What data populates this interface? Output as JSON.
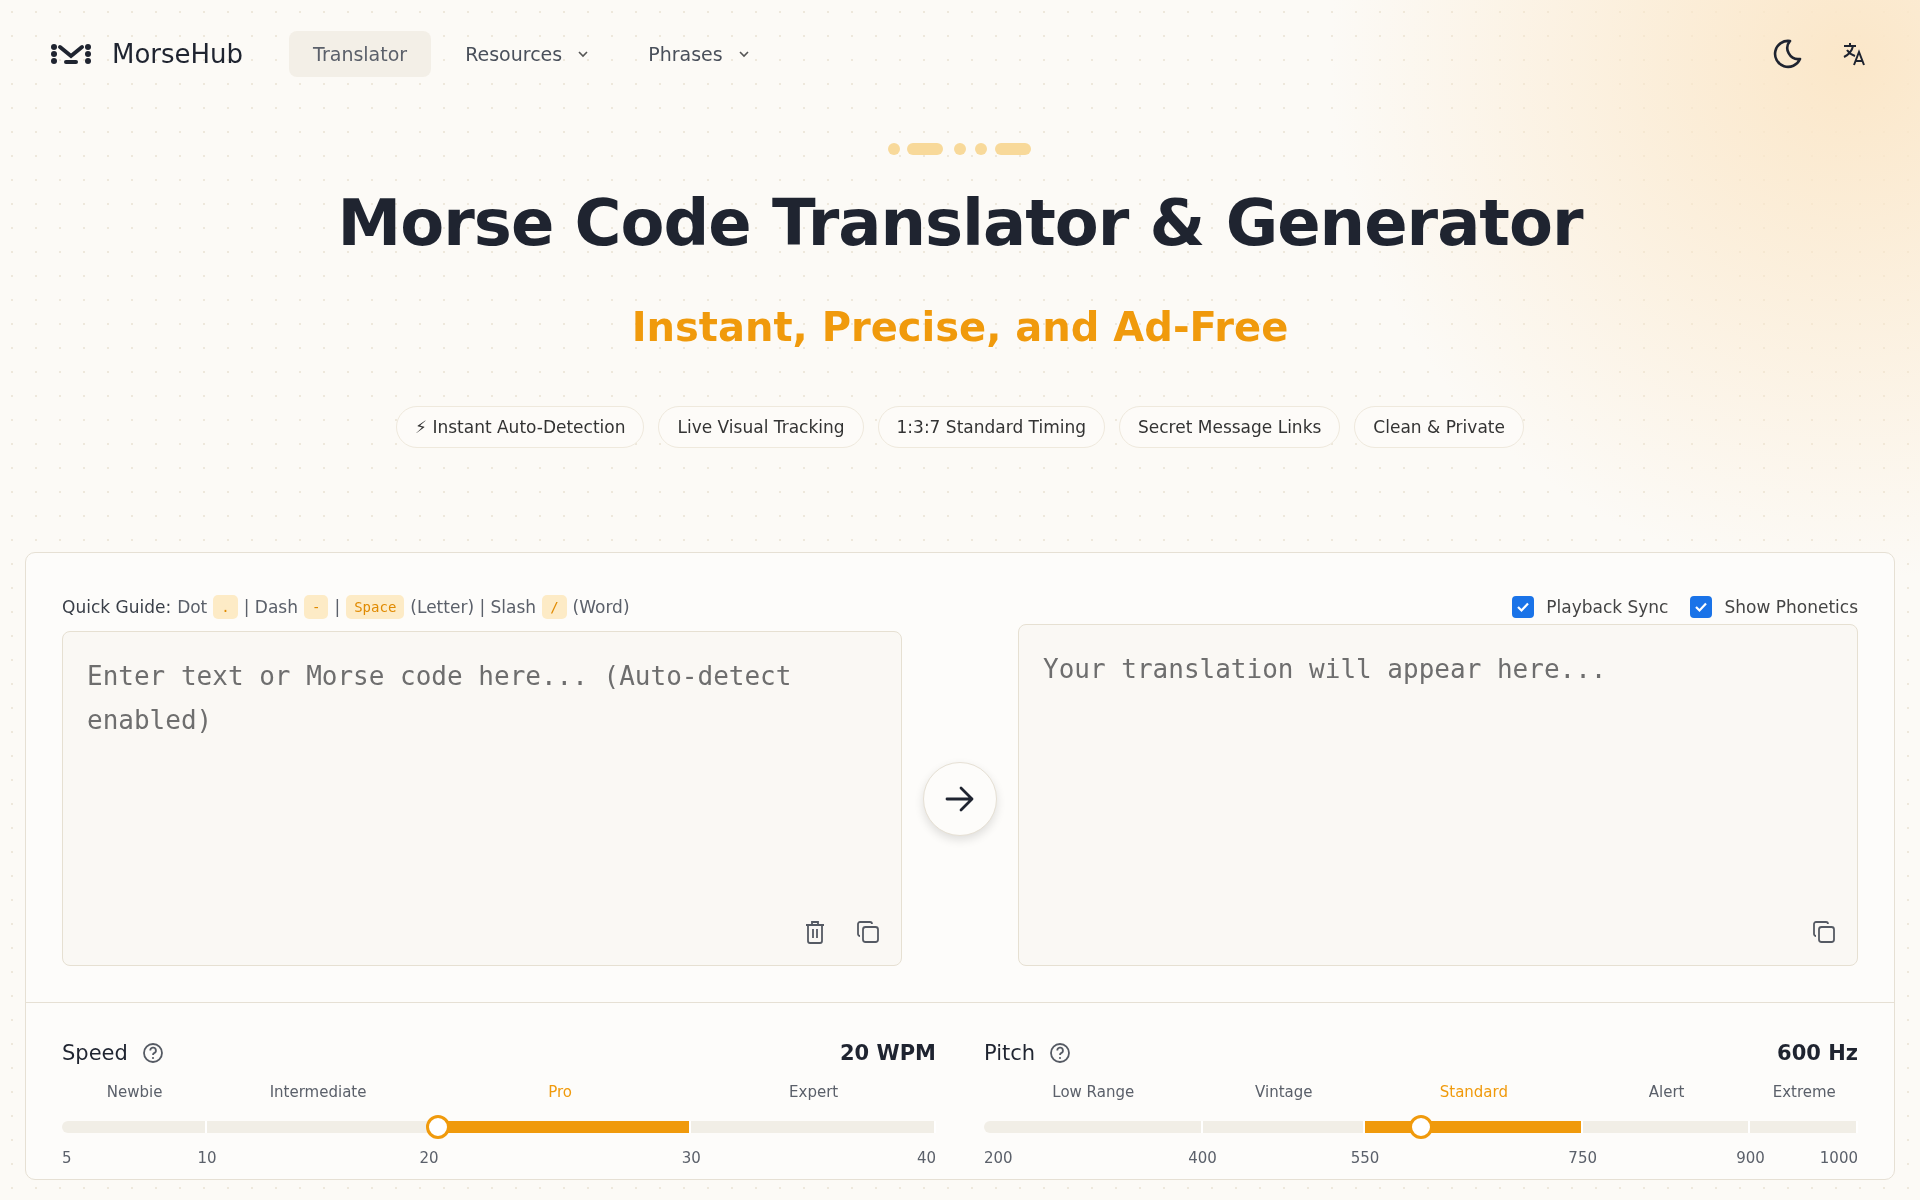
{
  "brand": {
    "name": "MorseHub"
  },
  "nav": [
    {
      "label": "Translator",
      "selected": true,
      "dropdown": false
    },
    {
      "label": "Resources",
      "selected": false,
      "dropdown": true
    },
    {
      "label": "Phrases",
      "selected": false,
      "dropdown": true
    }
  ],
  "hero": {
    "title": "Morse Code Translator & Generator",
    "subtitle": "Instant, Precise, and Ad-Free",
    "features": [
      {
        "label": "⚡ Instant Auto-Detection"
      },
      {
        "label": "Live Visual Tracking"
      },
      {
        "label": "1:3:7 Standard Timing"
      },
      {
        "label": "Secret Message Links"
      },
      {
        "label": "Clean & Private"
      }
    ]
  },
  "guide": {
    "label": "Quick Guide:",
    "parts": [
      {
        "kind": "text",
        "text": "Dot"
      },
      {
        "kind": "code",
        "text": "."
      },
      {
        "kind": "text",
        "text": "| Dash"
      },
      {
        "kind": "code",
        "text": "-"
      },
      {
        "kind": "text",
        "text": "|"
      },
      {
        "kind": "code",
        "text": "Space"
      },
      {
        "kind": "text",
        "text": "(Letter) | Slash"
      },
      {
        "kind": "code",
        "text": "/"
      },
      {
        "kind": "text",
        "text": "(Word)"
      }
    ]
  },
  "options": [
    {
      "label": "Playback Sync",
      "checked": true
    },
    {
      "label": "Show Phonetics",
      "checked": true
    }
  ],
  "input": {
    "placeholder": "Enter text or Morse code here... (Auto-detect enabled)"
  },
  "output": {
    "placeholder": "Your translation will appear here..."
  },
  "sliders": [
    {
      "label": "Speed",
      "reading": "20 WPM",
      "level": 0.43,
      "zones": [
        {
          "label": "Newbie",
          "selected": false
        },
        {
          "label": "Intermediate",
          "selected": false
        },
        {
          "label": "Pro",
          "selected": true
        },
        {
          "label": "Expert",
          "selected": false
        }
      ],
      "ticks": [
        "5",
        "10",
        "20",
        "30",
        "40"
      ]
    },
    {
      "label": "Pitch",
      "reading": "600 Hz",
      "level": 0.5,
      "zones": [
        {
          "label": "Low Range",
          "selected": false
        },
        {
          "label": "Vintage",
          "selected": false
        },
        {
          "label": "Standard",
          "selected": true
        },
        {
          "label": "Alert",
          "selected": false
        },
        {
          "label": "Extreme",
          "selected": false
        }
      ],
      "ticks": [
        "200",
        "400",
        "550",
        "750",
        "900",
        "1000"
      ]
    }
  ]
}
